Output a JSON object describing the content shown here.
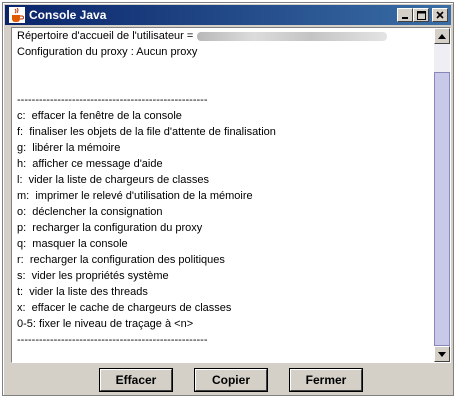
{
  "window": {
    "title": "Console Java",
    "icon": "java-cup-icon",
    "controls": [
      "minimize-icon",
      "maximize-icon",
      "close-icon"
    ]
  },
  "console": {
    "user_home_label": "Répertoire d'accueil de l'utilisateur =",
    "lines": [
      "Configuration du proxy : Aucun proxy",
      "",
      "",
      "----------------------------------------------------",
      "c:  effacer la fenêtre de la console",
      "f:  finaliser les objets de la file d'attente de finalisation",
      "g:  libérer la mémoire",
      "h:  afficher ce message d'aide",
      "l:  vider la liste de chargeurs de classes",
      "m:  imprimer le relevé d'utilisation de la mémoire",
      "o:  déclencher la consignation",
      "p:  recharger la configuration du proxy",
      "q:  masquer la console",
      "r:  recharger la configuration des politiques",
      "s:  vider les propriétés système",
      "t:  vider la liste des threads",
      "x:  effacer le cache de chargeurs de classes",
      "0-5: fixer le niveau de traçage à <n>",
      "----------------------------------------------------"
    ]
  },
  "buttons": {
    "effacer": "Effacer",
    "copier": "Copier",
    "fermer": "Fermer"
  },
  "colors": {
    "titlebar_start": "#0a246a",
    "titlebar_end": "#3a6ea5",
    "chrome": "#d4d0c8",
    "scroll_thumb": "#c8c8e8"
  }
}
